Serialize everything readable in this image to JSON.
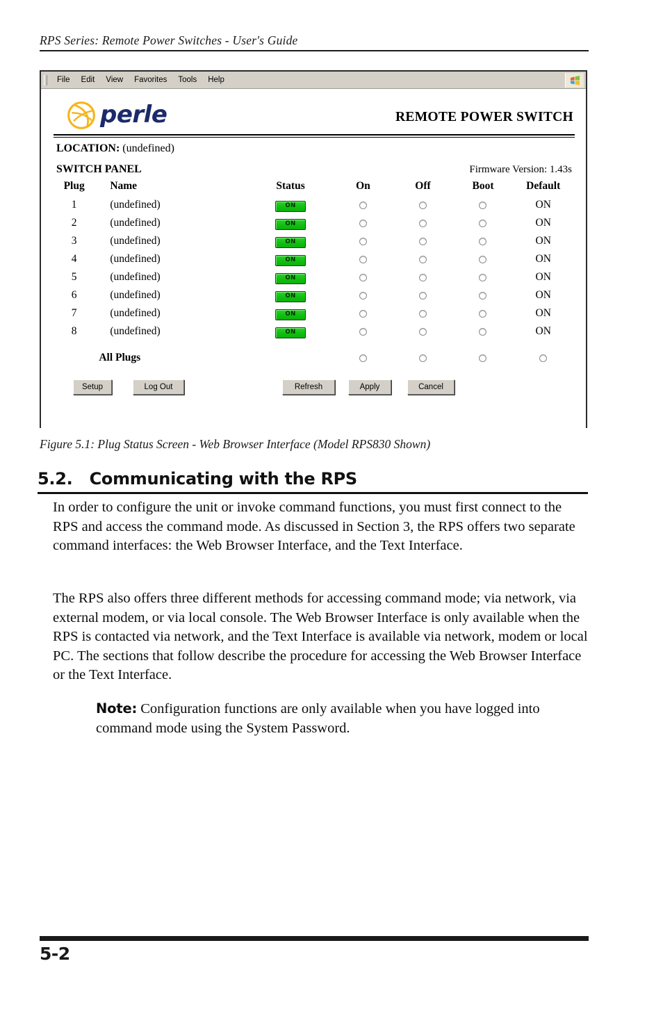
{
  "page": {
    "running_header": "RPS Series: Remote Power Switches - User's Guide",
    "footer_page_number": "5-2"
  },
  "browser": {
    "menu_items": [
      "File",
      "Edit",
      "View",
      "Favorites",
      "Tools",
      "Help"
    ],
    "logo_icon": "windows-flag-icon"
  },
  "app": {
    "brand_name": "perle",
    "brand_mark_icon": "perle-swoosh-logo",
    "title": "REMOTE POWER SWITCH",
    "location_label": "LOCATION:",
    "location_value": "(undefined)",
    "panel_title": "SWITCH PANEL",
    "firmware": "Firmware Version: 1.43s",
    "accent_color": "#1b2a6b",
    "logo_color": "#f5b51a",
    "on_badge_color": "#14c214"
  },
  "table": {
    "headers": {
      "plug": "Plug",
      "name": "Name",
      "status": "Status",
      "on": "On",
      "off": "Off",
      "boot": "Boot",
      "default": "Default"
    },
    "rows": [
      {
        "plug": "1",
        "name": "(undefined)",
        "status": "ON",
        "default": "ON"
      },
      {
        "plug": "2",
        "name": "(undefined)",
        "status": "ON",
        "default": "ON"
      },
      {
        "plug": "3",
        "name": "(undefined)",
        "status": "ON",
        "default": "ON"
      },
      {
        "plug": "4",
        "name": "(undefined)",
        "status": "ON",
        "default": "ON"
      },
      {
        "plug": "5",
        "name": "(undefined)",
        "status": "ON",
        "default": "ON"
      },
      {
        "plug": "6",
        "name": "(undefined)",
        "status": "ON",
        "default": "ON"
      },
      {
        "plug": "7",
        "name": "(undefined)",
        "status": "ON",
        "default": "ON"
      },
      {
        "plug": "8",
        "name": "(undefined)",
        "status": "ON",
        "default": "ON"
      }
    ],
    "all_plugs_label": "All Plugs"
  },
  "buttons": {
    "setup": "Setup",
    "logout": "Log Out",
    "refresh": "Refresh",
    "apply": "Apply",
    "cancel": "Cancel"
  },
  "figure": {
    "caption": "Figure 5.1:  Plug Status Screen - Web Browser Interface (Model RPS830 Shown)"
  },
  "section": {
    "heading": "5.2.   Communicating with the RPS",
    "paragraph_1": "In order to configure the unit or invoke command functions, you must first connect to the RPS and access the command mode.  As discussed in Section 3, the RPS offers two separate command interfaces: the Web Browser Interface, and the Text Interface.",
    "paragraph_2": "The RPS also offers three different methods for accessing command mode; via network, via external modem, or via local console.  The Web Browser Interface is only available when the RPS is contacted via network, and the Text Interface is available via network, modem or local PC.  The sections that follow describe the procedure for accessing the Web Browser Interface or the Text Interface.",
    "note_label": "Note:",
    "note_text": "Configuration functions are only available when you have logged into command mode using the System Password."
  }
}
